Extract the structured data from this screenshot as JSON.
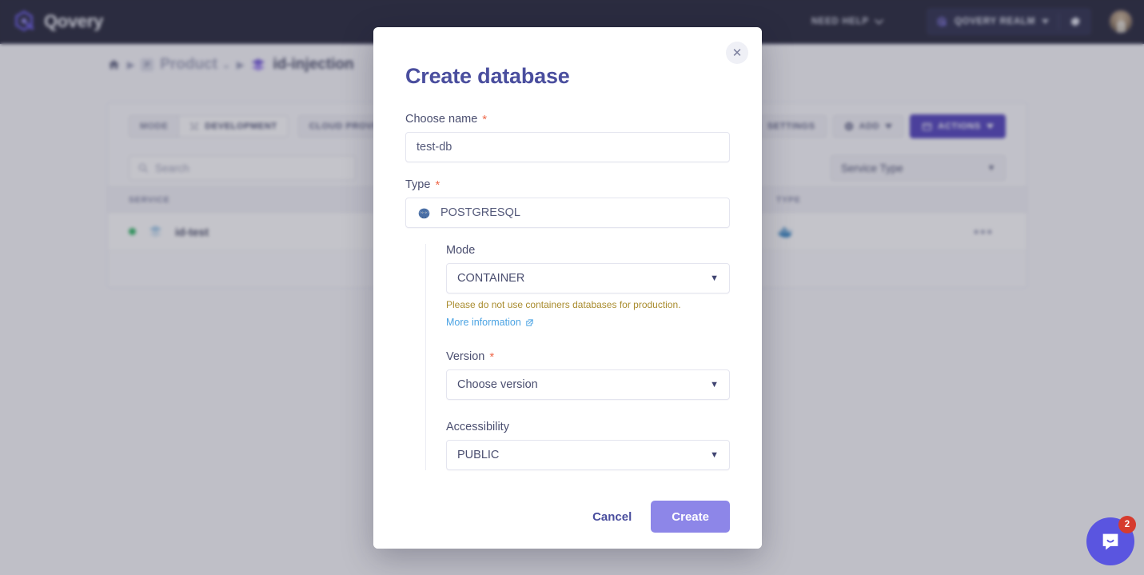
{
  "navbar": {
    "brand": "Qovery",
    "logo_icon": "qovery-hexagon-logo",
    "need_help": "NEED HELP",
    "need_help_caret_icon": "chevron-down-icon",
    "realm": "QOVERY REALM",
    "realm_icon": "qovery-mark-icon",
    "realm_caret_icon": "caret-down-icon",
    "settings_icon": "gear-icon",
    "avatar_icon": "user-avatar"
  },
  "breadcrumb": {
    "home_icon": "home-icon",
    "arrow_icon": "arrow-right-icon",
    "project_chip": "P",
    "project": "Product",
    "project_caret_icon": "chevron-down-icon",
    "environment_icon": "environment-layers-icon",
    "environment": "id-injection"
  },
  "toolbar": {
    "mode_label": "MODE",
    "mode_value": "DEVELOPMENT",
    "mode_icon": "tools-icon",
    "cloud_provider_label": "CLOUD PROVIDER",
    "settings_label": "SETTINGS",
    "settings_icon": "gear-icon",
    "add_label": "ADD",
    "add_icon": "plus-circle-icon",
    "add_caret_icon": "caret-down-icon",
    "actions_label": "ACTIONS",
    "actions_icon": "terminal-icon",
    "actions_caret_icon": "caret-down-icon"
  },
  "filters": {
    "search_placeholder": "Search",
    "search_icon": "search-icon",
    "search_value": "",
    "service_type": "Service Type",
    "service_type_caret_icon": "caret-down-icon"
  },
  "table": {
    "columns": {
      "service": "SERVICE",
      "type": "TYPE"
    },
    "rows": [
      {
        "status": "running",
        "status_color": "#24b35c",
        "icon": "database-layers-icon",
        "name": "id-test",
        "type_icon": "docker-whale-icon",
        "menu_icon": "ellipsis-icon"
      }
    ]
  },
  "modal": {
    "title": "Create database",
    "close_icon": "close-icon",
    "fields": {
      "name_label": "Choose name",
      "name_required": "*",
      "name_value": "test-db",
      "type_label": "Type",
      "type_required": "*",
      "type_value": "POSTGRESQL",
      "type_icon": "postgresql-elephant-icon",
      "mode_label": "Mode",
      "mode_value": "CONTAINER",
      "mode_caret_icon": "caret-down-icon",
      "mode_warning": "Please do not use containers databases for production.",
      "mode_link": "More information",
      "mode_link_icon": "external-link-icon",
      "version_label": "Version",
      "version_required": "*",
      "version_value": "Choose version",
      "version_caret_icon": "caret-down-icon",
      "accessibility_label": "Accessibility",
      "accessibility_value": "PUBLIC",
      "accessibility_caret_icon": "caret-down-icon"
    },
    "footer": {
      "cancel": "Cancel",
      "create": "Create"
    }
  },
  "chat": {
    "icon": "chat-bubble-icon",
    "badge": "2"
  },
  "colors": {
    "brand_purple": "#4535b8",
    "modal_title": "#4a4e9e",
    "create_button": "#8d86e8",
    "navbar_bg": "#15162b",
    "status_ok": "#24b35c",
    "warning_text": "#a98c2e",
    "link_blue": "#4ba3e3",
    "required_star": "#ef6a4c"
  }
}
